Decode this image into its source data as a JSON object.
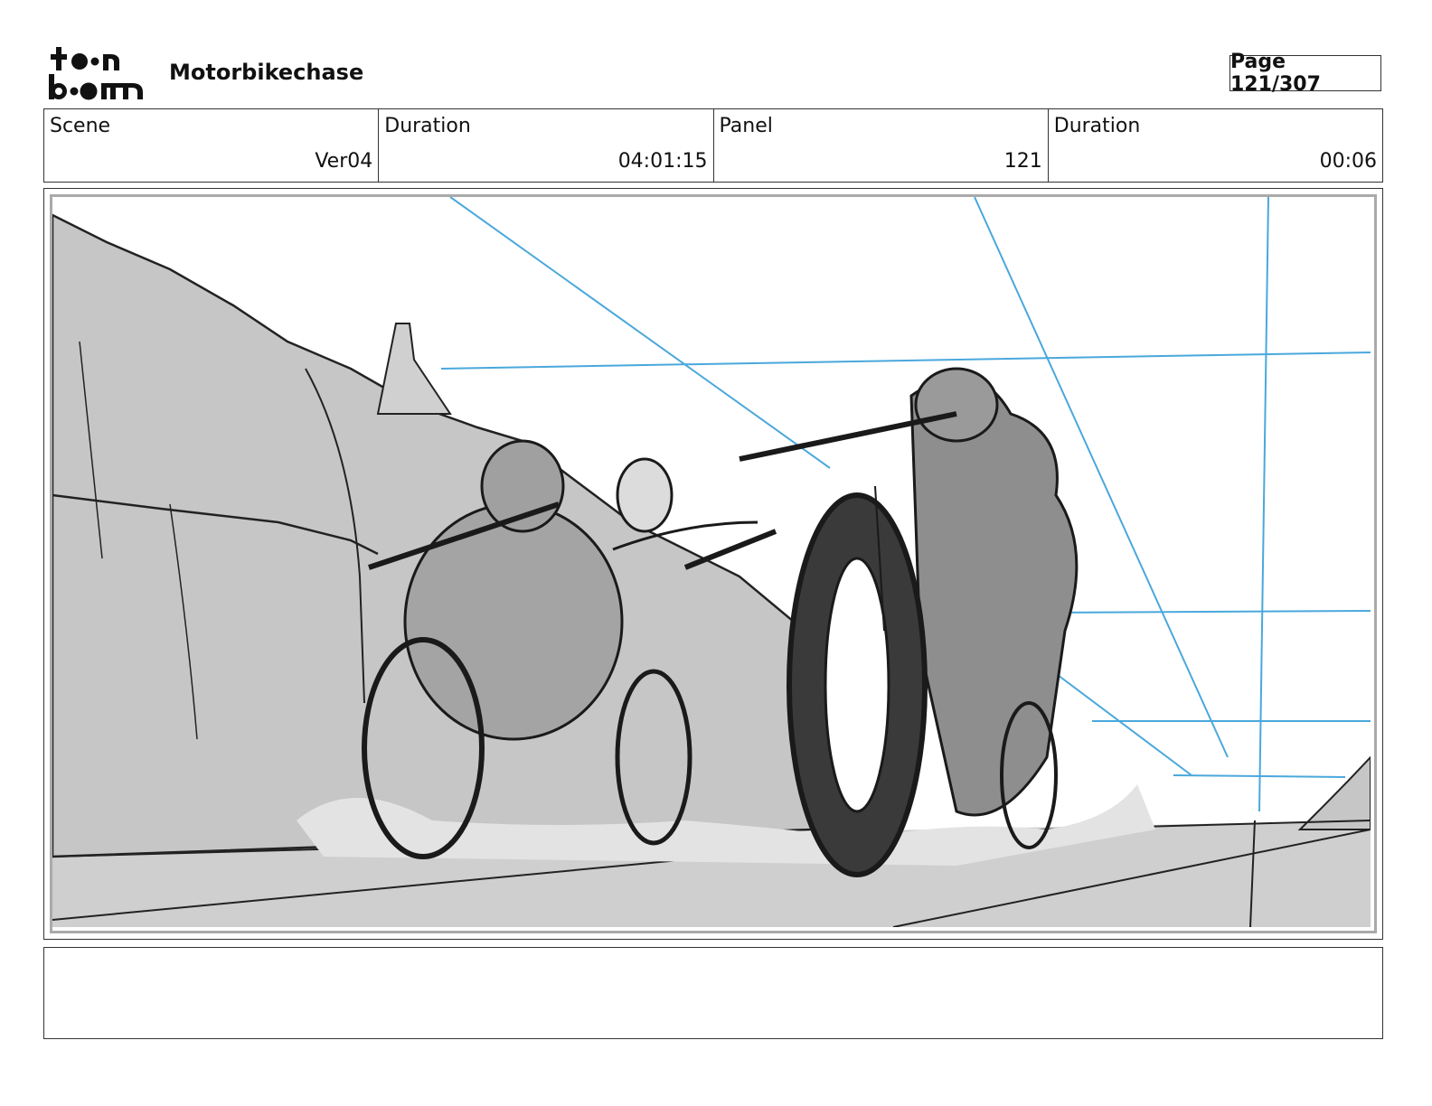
{
  "logo": {
    "line1": "t•n",
    "line2": "b•m",
    "colors": {
      "ink": "#111111"
    }
  },
  "header": {
    "project_title": "Motorbikechase",
    "page_label": "Page 121/307"
  },
  "info": [
    {
      "label": "Scene",
      "value": "Ver04"
    },
    {
      "label": "Duration",
      "value": "04:01:15"
    },
    {
      "label": "Panel",
      "value": "121"
    },
    {
      "label": "Duration",
      "value": "00:06"
    }
  ],
  "panel": {
    "description_icon": "storyboard-sketch-motorbike-chase",
    "colors": {
      "guide": "#4aa8dc",
      "shade": "#c8c8c8",
      "dark": "#8a8a8a",
      "ink": "#1a1a1a"
    }
  },
  "notes": {
    "text": ""
  }
}
